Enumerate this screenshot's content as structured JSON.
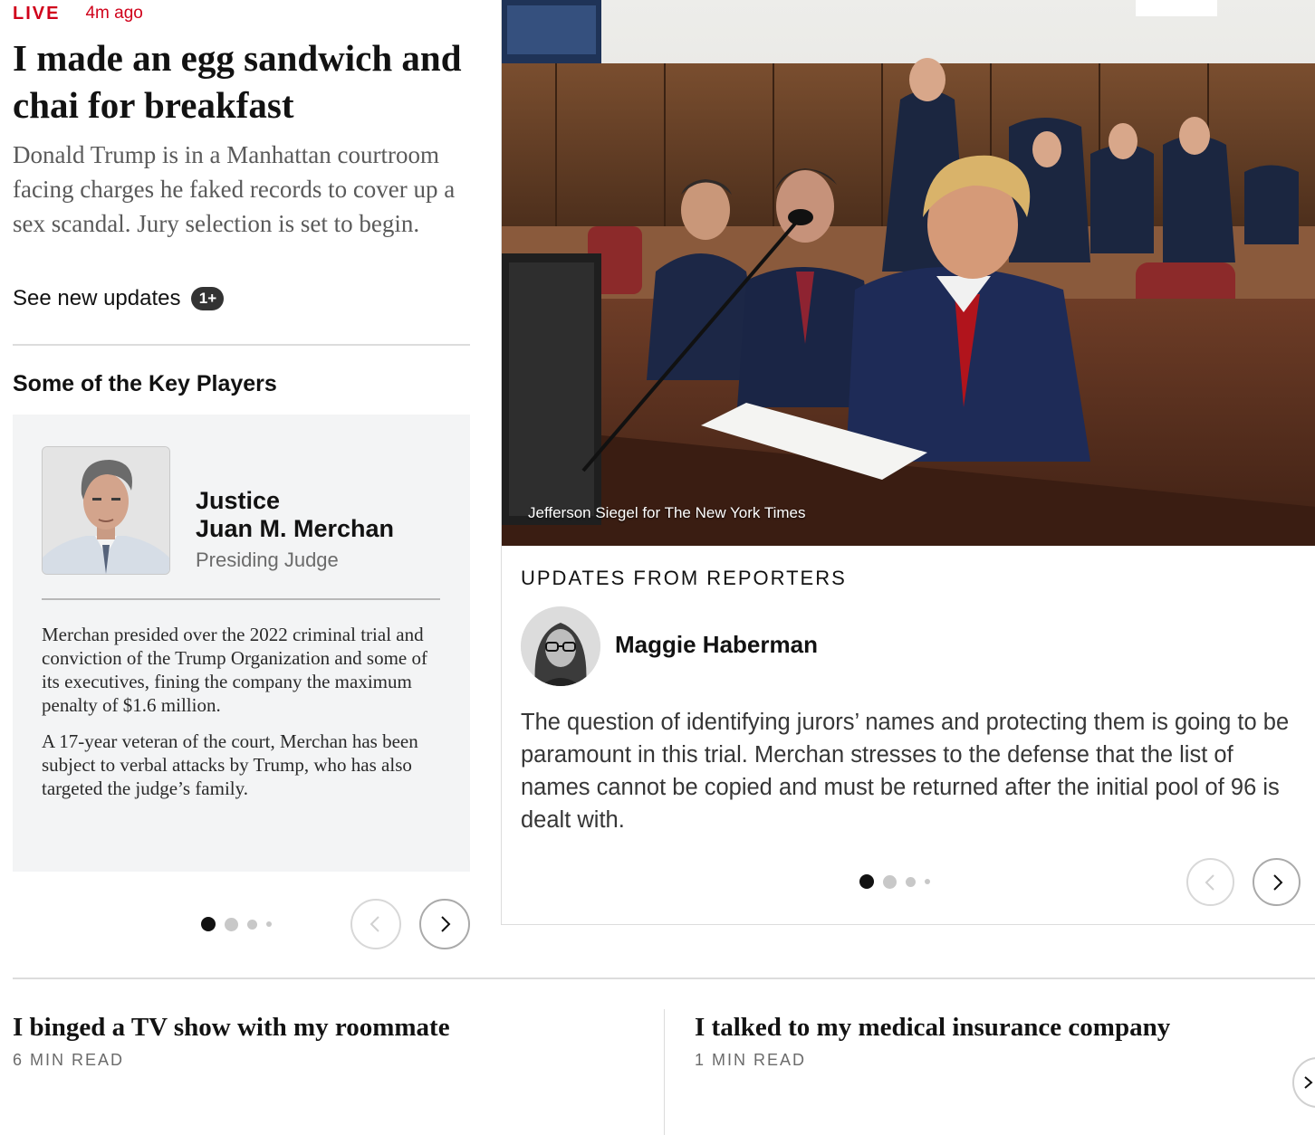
{
  "live": {
    "label": "LIVE",
    "time": "4m ago"
  },
  "main_story": {
    "headline": "I made an egg sandwich and chai for breakfast",
    "summary": "Donald Trump is in a Manhattan courtroom facing charges he faked records to cover up a sex scandal. Jury selection is set to begin.",
    "updates_link": "See new updates",
    "updates_badge": "1+"
  },
  "key_players": {
    "title": "Some of the Key Players",
    "card": {
      "name_line1": "Justice",
      "name_line2": "Juan M. Merchan",
      "role": "Presiding Judge",
      "bio": [
        "Merchan presided over the 2022 criminal trial and conviction of the Trump Organization and some of its executives, fining the company the maximum penalty of $1.6 million.",
        "A 17-year veteran of the court, Merchan has been subject to verbal attacks by Trump, who has also targeted the judge’s family."
      ]
    }
  },
  "hero": {
    "credit": "Jefferson Siegel for The New York Times"
  },
  "reporters": {
    "heading": "UPDATES FROM REPORTERS",
    "name": "Maggie Haberman",
    "update": "The question of identifying jurors’ names and protecting them is going to be paramount in this trial. Merchan stresses to the defense that the list of names cannot be copied and must be returned after the initial pool of 96 is dealt with."
  },
  "bottom_stories": [
    {
      "title": "I binged a TV show with my roommate",
      "meta": "6 MIN READ"
    },
    {
      "title": "I talked to my medical insurance company",
      "meta": "1 MIN READ"
    }
  ],
  "colors": {
    "live_red": "#d0021b",
    "text_dark": "#121212",
    "text_muted": "#5a5a5a",
    "card_bg": "#f3f4f5"
  },
  "icons": {
    "prev": "chevron-left-icon",
    "next": "chevron-right-icon"
  }
}
